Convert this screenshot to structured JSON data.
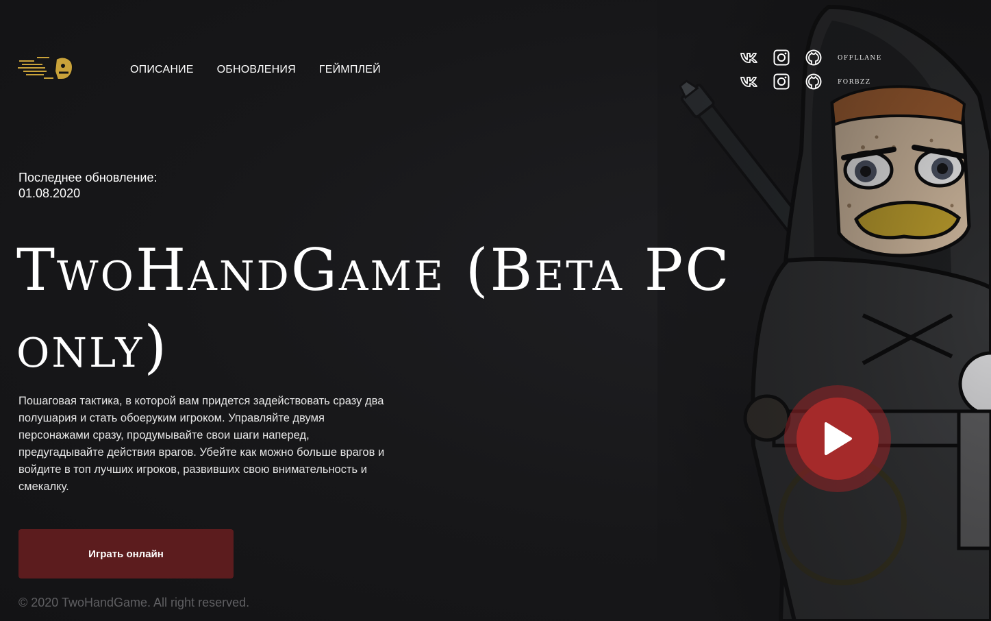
{
  "header": {
    "logo_icon": "twohandgame-logo",
    "nav": [
      {
        "label": "ОПИСАНИЕ"
      },
      {
        "label": "ОБНОВЛЕНИЯ"
      },
      {
        "label": "ГЕЙМПЛЕЙ"
      }
    ]
  },
  "socials": [
    {
      "name": "offllane",
      "icons": [
        "vk-icon",
        "instagram-icon",
        "github-icon"
      ]
    },
    {
      "name": "forbzz",
      "icons": [
        "vk-icon",
        "instagram-icon",
        "github-icon"
      ]
    }
  ],
  "main": {
    "update_label": "Последнее обновление:",
    "update_date": "01.08.2020",
    "title": "TwoHandGame (Beta PC only)",
    "description": "Пошаговая тактика, в которой вам придется задействовать сразу два полушария и стать обоеруким игроком. Управляйте двумя персонажами сразу, продумывайте свои шаги наперед, предугадывайте действия врагов. Убейте как можно больше врагов и войдите в топ лучших игроков, развивших свою внимательность и смекалку.",
    "play_button": "Играть онлайн"
  },
  "footer": {
    "copyright": "© 2020 TwoHandGame. All right reserved."
  },
  "colors": {
    "background": "#161618",
    "button": "#5c1c1e",
    "video_button": "#a52a2a",
    "copyright_text": "#5f5f62"
  }
}
